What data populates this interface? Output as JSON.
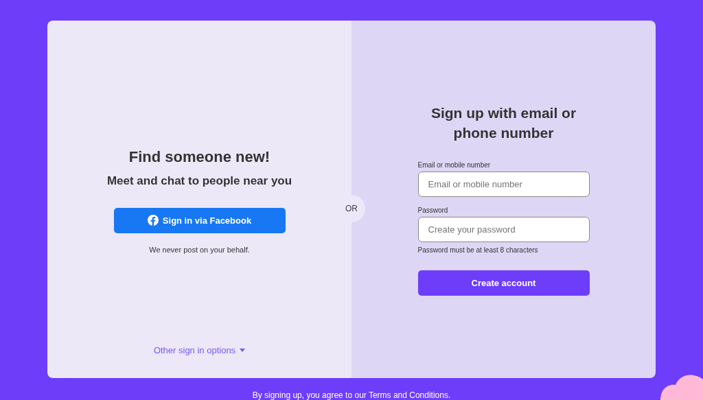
{
  "left_panel": {
    "title": "Find someone new!",
    "subtitle": "Meet and chat to people near you",
    "facebook_button": "Sign in via Facebook",
    "note": "We never post on your behalf.",
    "other_options": "Other sign in options"
  },
  "divider": "OR",
  "right_panel": {
    "title": "Sign up with email or phone number",
    "fields": [
      {
        "label": "Email or mobile number",
        "placeholder": "Email or mobile number"
      },
      {
        "label": "Password",
        "placeholder": "Create your password",
        "hint": "Password must be at least 8 characters"
      }
    ],
    "submit_button": "Create account"
  },
  "footer": "By signing up, you agree to our Terms and Conditions."
}
